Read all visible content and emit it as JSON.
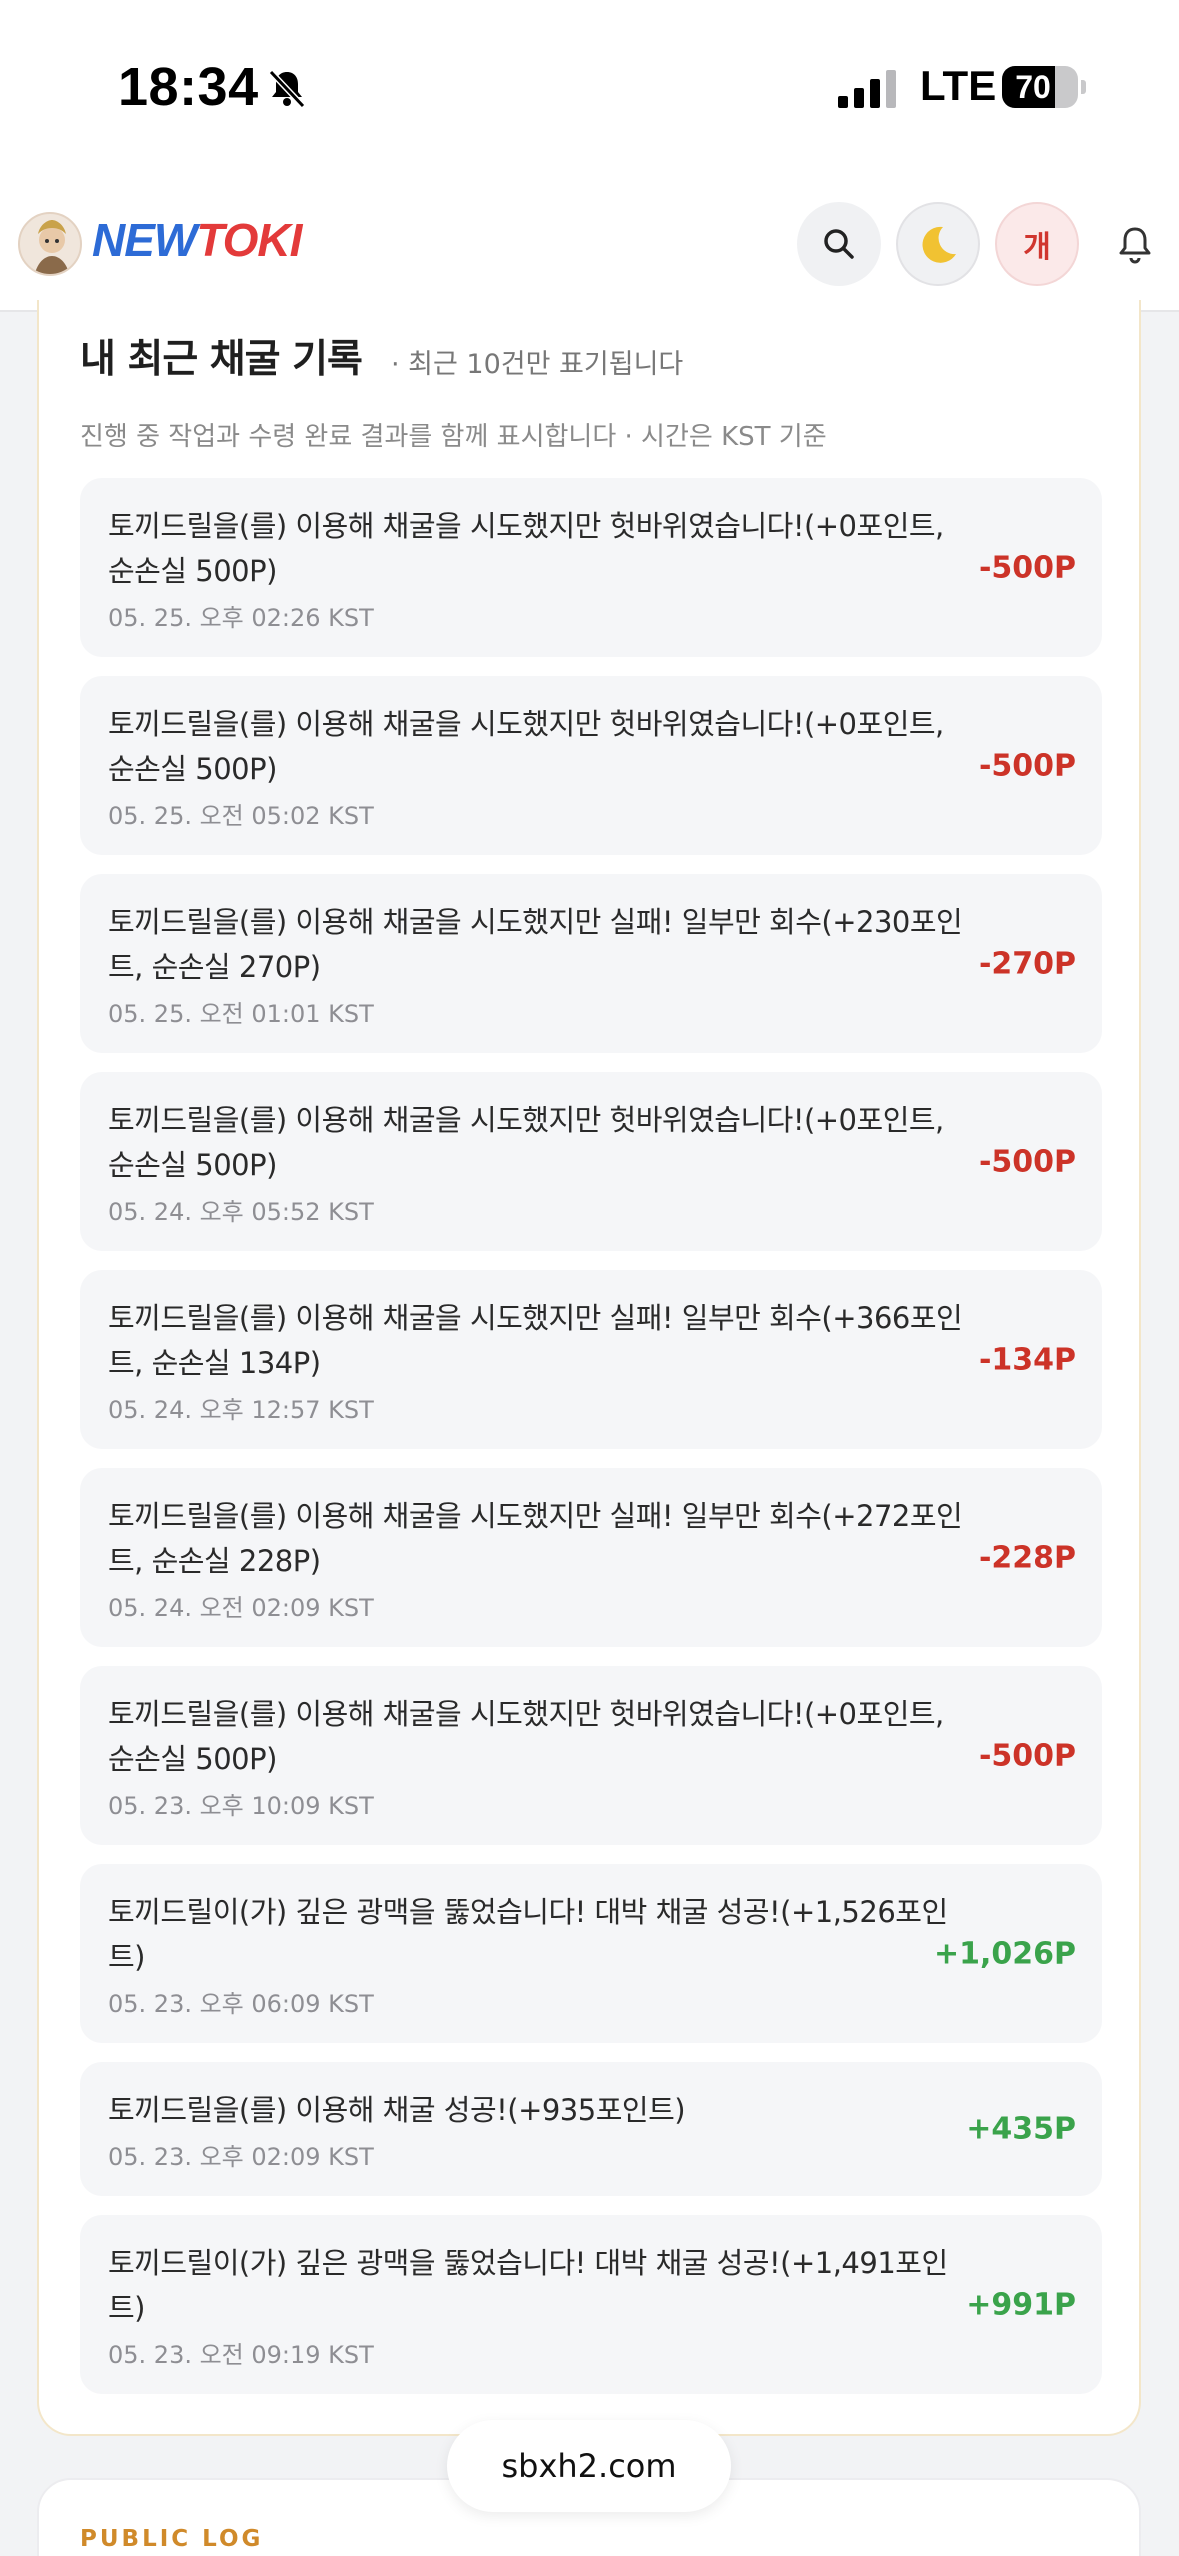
{
  "status": {
    "time": "18:34",
    "network": "LTE",
    "battery": "70",
    "battery_level": 0.7
  },
  "header": {
    "logo_new": "NEW",
    "logo_toki": "TOKI",
    "user_initial": "개"
  },
  "card": {
    "title": "내 최근 채굴 기록",
    "note": "· 최근 10건만 표기됩니다",
    "subtitle": "진행 중 작업과 수령 완료 결과를 함께 표시합니다 · 시간은 KST 기준"
  },
  "logs": [
    {
      "msg": "토끼드릴을(를) 이용해 채굴을 시도했지만 헛바위였습니다!(+0포인트, 순손실 500P)",
      "time": "05. 25. 오후 02:26 KST",
      "amount": "-500P",
      "sign": "neg"
    },
    {
      "msg": "토끼드릴을(를) 이용해 채굴을 시도했지만 헛바위였습니다!(+0포인트, 순손실 500P)",
      "time": "05. 25. 오전 05:02 KST",
      "amount": "-500P",
      "sign": "neg"
    },
    {
      "msg": "토끼드릴을(를) 이용해 채굴을 시도했지만 실패! 일부만 회수(+230포인트, 순손실 270P)",
      "time": "05. 25. 오전 01:01 KST",
      "amount": "-270P",
      "sign": "neg"
    },
    {
      "msg": "토끼드릴을(를) 이용해 채굴을 시도했지만 헛바위였습니다!(+0포인트, 순손실 500P)",
      "time": "05. 24. 오후 05:52 KST",
      "amount": "-500P",
      "sign": "neg"
    },
    {
      "msg": "토끼드릴을(를) 이용해 채굴을 시도했지만 실패! 일부만 회수(+366포인트, 순손실 134P)",
      "time": "05. 24. 오후 12:57 KST",
      "amount": "-134P",
      "sign": "neg"
    },
    {
      "msg": "토끼드릴을(를) 이용해 채굴을 시도했지만 실패! 일부만 회수(+272포인트, 순손실 228P)",
      "time": "05. 24. 오전 02:09 KST",
      "amount": "-228P",
      "sign": "neg"
    },
    {
      "msg": "토끼드릴을(를) 이용해 채굴을 시도했지만 헛바위였습니다!(+0포인트, 순손실 500P)",
      "time": "05. 23. 오후 10:09 KST",
      "amount": "-500P",
      "sign": "neg"
    },
    {
      "msg": "토끼드릴이(가) 깊은 광맥을 뚫었습니다! 대박 채굴 성공!(+1,526포인트)",
      "time": "05. 23. 오후 06:09 KST",
      "amount": "+1,026P",
      "sign": "pos"
    },
    {
      "msg": "토끼드릴을(를) 이용해 채굴 성공!(+935포인트)",
      "time": "05. 23. 오후 02:09 KST",
      "amount": "+435P",
      "sign": "pos"
    },
    {
      "msg": "토끼드릴이(가) 깊은 광맥을 뚫었습니다! 대박 채굴 성공!(+1,491포인트)",
      "time": "05. 23. 오전 09:19 KST",
      "amount": "+991P",
      "sign": "pos"
    }
  ],
  "url": "sbxh2.com",
  "public_log_label": "PUBLIC LOG",
  "colors": {
    "negative": "#cc3328",
    "positive": "#3aa34b",
    "accent": "#d08a2a"
  }
}
